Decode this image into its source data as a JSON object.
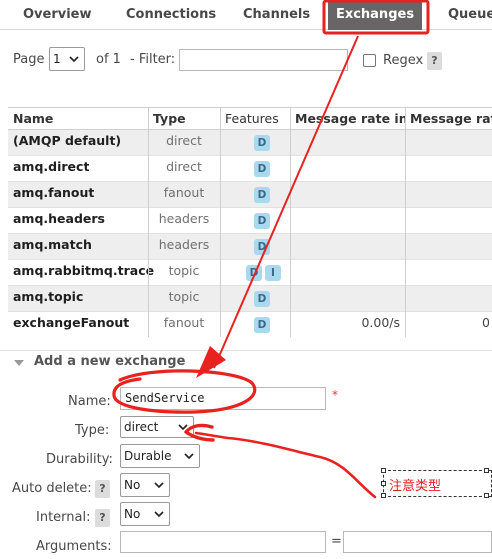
{
  "tabs": [
    {
      "label": "Overview",
      "active": false
    },
    {
      "label": "Connections",
      "active": false
    },
    {
      "label": "Channels",
      "active": false
    },
    {
      "label": "Exchanges",
      "active": true
    },
    {
      "label": "Queue",
      "active": false
    }
  ],
  "paging": {
    "page_label": "Page",
    "page_value": "1",
    "of_label": "of 1",
    "filter_label": "- Filter:",
    "filter_value": "",
    "regex_label": "Regex",
    "regex_checked": false,
    "help": "?"
  },
  "table": {
    "columns": [
      "Name",
      "Type",
      "Features",
      "Message rate in",
      "Message rat"
    ],
    "rows": [
      {
        "name": "(AMQP default)",
        "type": "direct",
        "features": [
          "D"
        ],
        "rate_in": "",
        "rate_out": ""
      },
      {
        "name": "amq.direct",
        "type": "direct",
        "features": [
          "D"
        ],
        "rate_in": "",
        "rate_out": ""
      },
      {
        "name": "amq.fanout",
        "type": "fanout",
        "features": [
          "D"
        ],
        "rate_in": "",
        "rate_out": ""
      },
      {
        "name": "amq.headers",
        "type": "headers",
        "features": [
          "D"
        ],
        "rate_in": "",
        "rate_out": ""
      },
      {
        "name": "amq.match",
        "type": "headers",
        "features": [
          "D"
        ],
        "rate_in": "",
        "rate_out": ""
      },
      {
        "name": "amq.rabbitmq.trace",
        "type": "topic",
        "features": [
          "D",
          "I"
        ],
        "rate_in": "",
        "rate_out": ""
      },
      {
        "name": "amq.topic",
        "type": "topic",
        "features": [
          "D"
        ],
        "rate_in": "",
        "rate_out": ""
      },
      {
        "name": "exchangeFanout",
        "type": "fanout",
        "features": [
          "D"
        ],
        "rate_in": "0.00/s",
        "rate_out": "0"
      }
    ]
  },
  "form": {
    "section_title": "Add a new exchange",
    "name_label": "Name:",
    "name_value": "SendService",
    "required_mark": "*",
    "type_label": "Type:",
    "type_value": "direct",
    "durability_label": "Durability:",
    "durability_value": "Durable",
    "auto_delete_label": "Auto delete:",
    "auto_delete_value": "No",
    "internal_label": "Internal:",
    "internal_value": "No",
    "arguments_label": "Arguments:",
    "equals": "=",
    "help": "?"
  },
  "annotation": {
    "note_text": "注意类型",
    "ink_color": "#e8231f"
  }
}
